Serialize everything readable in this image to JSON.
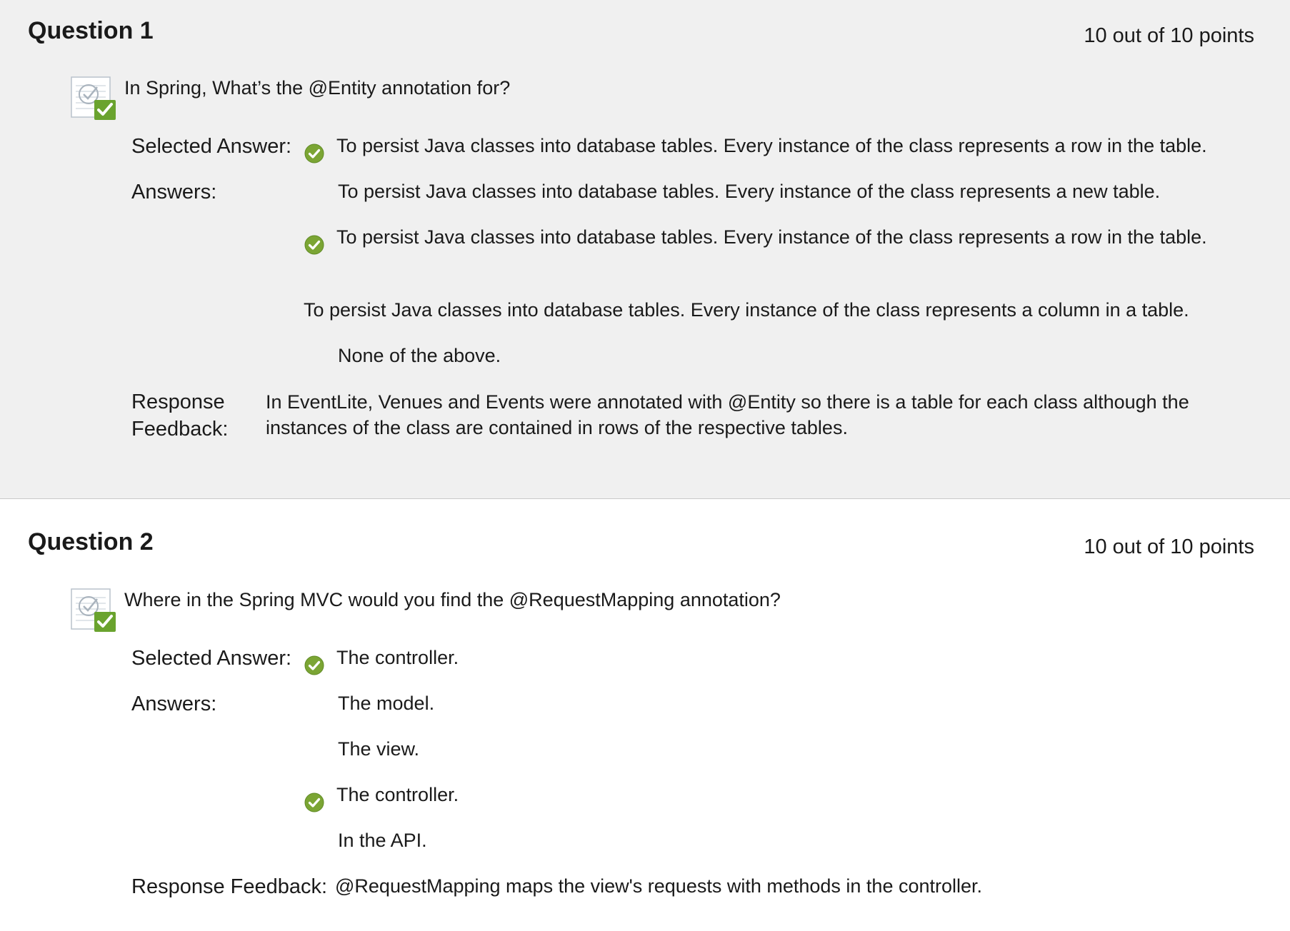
{
  "question1": {
    "title": "Question 1",
    "points": "10 out of 10 points",
    "text": "In Spring, What’s the @Entity annotation for?",
    "selected_label": "Selected Answer:",
    "selected_answer": "To persist Java classes into database tables. Every instance of the class represents a row in the table.",
    "answers_label": "Answers:",
    "answers": [
      "To persist Java classes into database tables. Every instance of the class represents a new table.",
      "To persist Java classes into database tables. Every instance of the class represents a row in the table.",
      "To persist Java classes into database tables. Every instance of the class represents a column in a table.",
      "None of the above."
    ],
    "feedback_label_line1": "Response",
    "feedback_label_line2": "Feedback:",
    "feedback": "In EventLite, Venues and Events were annotated with @Entity so there is a table for each class although the instances of the class are contained in rows of the respective tables."
  },
  "question2": {
    "title": "Question 2",
    "points": "10 out of 10 points",
    "text": "Where in the Spring MVC would you find the @RequestMapping annotation?",
    "selected_label": "Selected Answer:",
    "selected_answer": "The controller.",
    "answers_label": "Answers:",
    "answers": [
      "The model.",
      "The view.",
      "The controller.",
      "In the API."
    ],
    "feedback_label": "Response Feedback:",
    "feedback": "@RequestMapping maps the view's requests with methods in the controller."
  },
  "icons": {
    "question_status": "graded-correct-icon",
    "answer_marker": "correct-check-icon"
  },
  "colors": {
    "check_green": "#7ba534",
    "icon_badge_green": "#6aa32e",
    "graded_section_bg": "#f0f0f0"
  }
}
